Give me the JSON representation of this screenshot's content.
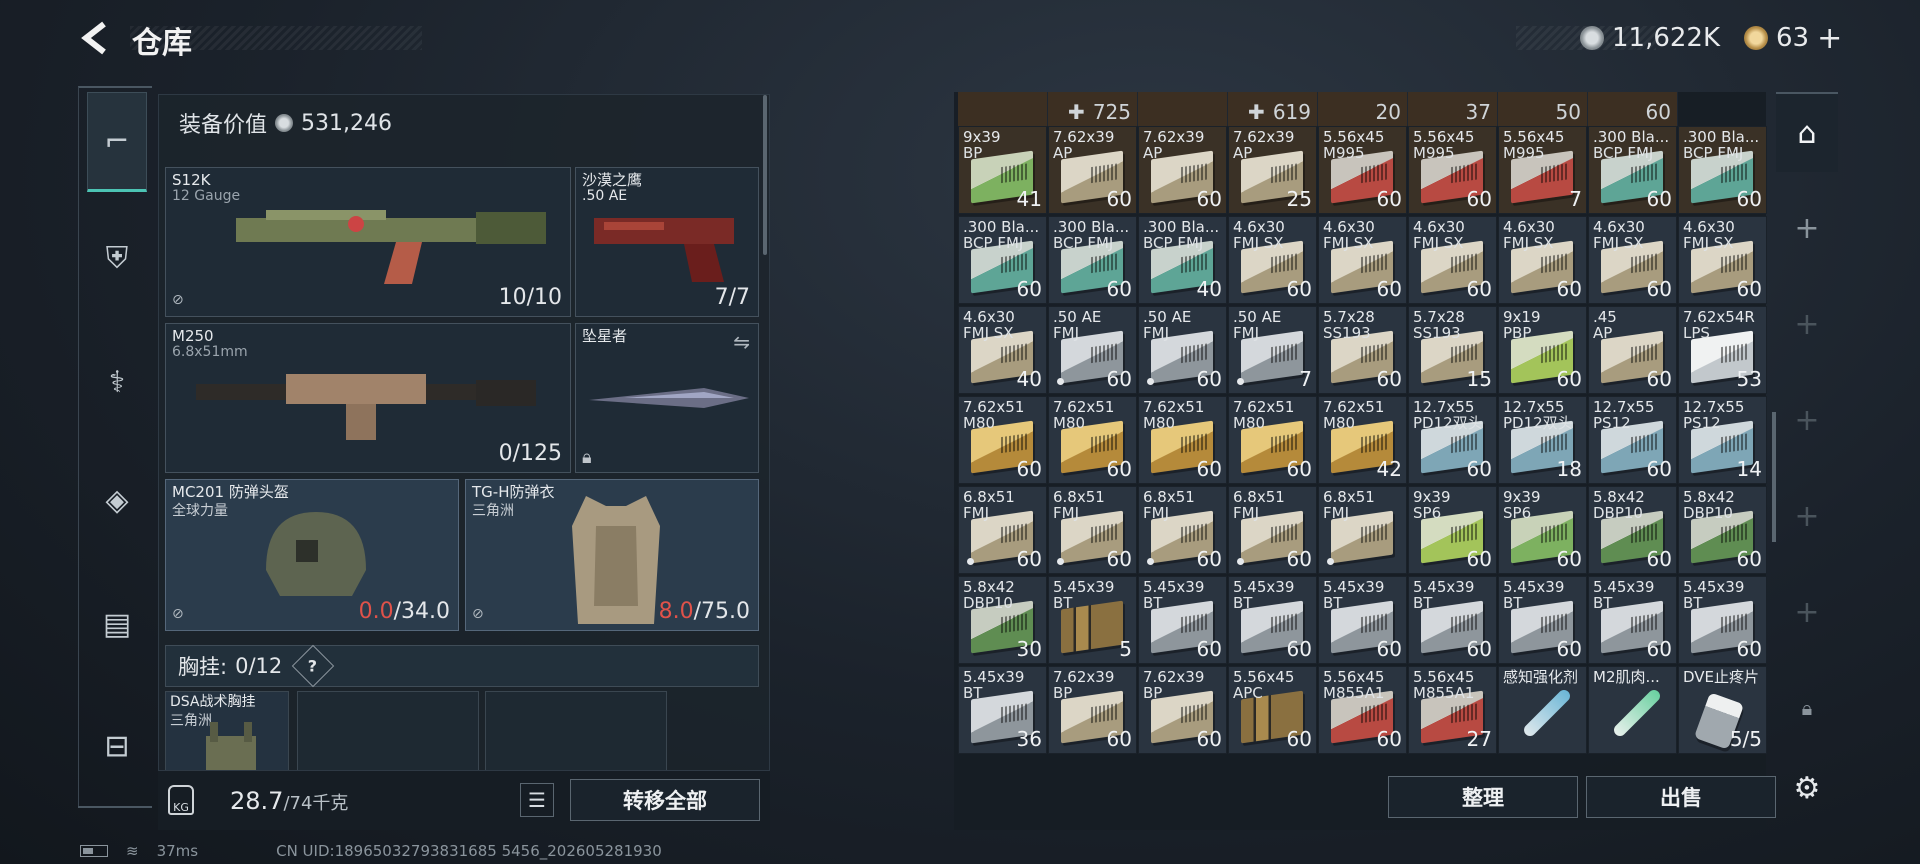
{
  "header": {
    "title": "仓库",
    "currency_silver": "11,622K",
    "currency_gold": "63",
    "plus": "+"
  },
  "equipment": {
    "value_label": "装备价值",
    "value": "531,246",
    "primary": {
      "name": "S12K",
      "ammo": "12 Gauge",
      "count": "10/10"
    },
    "sidearm": {
      "name": "沙漠之鹰",
      "ammo": ".50 AE",
      "count": "7/7"
    },
    "secondary": {
      "name": "M250",
      "ammo": "6.8x51mm",
      "count": "0/125"
    },
    "melee": {
      "name": "坠星者"
    },
    "helmet": {
      "name": "MC201 防弹头盔",
      "brand": "全球力量",
      "dur_current": "0.0",
      "dur_max": "/34.0"
    },
    "armor": {
      "name": "TG-H防弹衣",
      "brand": "三角洲",
      "dur_current": "8.0",
      "dur_max": "/75.0"
    },
    "vest": {
      "label": "胸挂:",
      "capacity": "0/12",
      "help": "?",
      "item_name": "DSA战术胸挂",
      "item_brand": "三角洲"
    },
    "weight": "28.7",
    "weight_max": "/74千克",
    "transfer_all": "转移全部"
  },
  "inventory": {
    "top_row": [
      {
        "prefix": "",
        "q": ""
      },
      {
        "prefix": "✚",
        "q": "725"
      },
      {
        "prefix": "",
        "q": ""
      },
      {
        "prefix": "✚",
        "q": "619"
      },
      {
        "prefix": "",
        "q": "20"
      },
      {
        "prefix": "",
        "q": "37"
      },
      {
        "prefix": "",
        "q": "50"
      },
      {
        "prefix": "",
        "q": "60"
      }
    ],
    "rows": [
      [
        {
          "l1": "9x39",
          "l2": "BP",
          "q": "41",
          "c": "green",
          "w": 1
        },
        {
          "l1": "7.62x39",
          "l2": "AP",
          "q": "60",
          "c": "beige",
          "w": 1
        },
        {
          "l1": "7.62x39",
          "l2": "AP",
          "q": "60",
          "c": "beige",
          "w": 1
        },
        {
          "l1": "7.62x39",
          "l2": "AP",
          "q": "25",
          "c": "beige",
          "w": 1
        },
        {
          "l1": "5.56x45",
          "l2": "M995",
          "q": "60",
          "c": "red",
          "w": 1
        },
        {
          "l1": "5.56x45",
          "l2": "M995",
          "q": "60",
          "c": "red",
          "w": 1
        },
        {
          "l1": "5.56x45",
          "l2": "M995",
          "q": "7",
          "c": "red",
          "w": 1
        },
        {
          "l1": ".300 Bla...",
          "l2": "BCP FMJ",
          "q": "60",
          "c": "teal",
          "w": 0
        },
        {
          "l1": ".300 Bla...",
          "l2": "BCP FMJ",
          "q": "60",
          "c": "teal",
          "w": 0
        }
      ],
      [
        {
          "l1": ".300 Bla...",
          "l2": "BCP FMJ",
          "q": "60",
          "c": "teal"
        },
        {
          "l1": ".300 Bla...",
          "l2": "BCP FMJ",
          "q": "60",
          "c": "teal"
        },
        {
          "l1": ".300 Bla...",
          "l2": "BCP FMJ",
          "q": "40",
          "c": "teal"
        },
        {
          "l1": "4.6x30",
          "l2": "FMJ SX",
          "q": "60",
          "c": "beige"
        },
        {
          "l1": "4.6x30",
          "l2": "FMJ SX",
          "q": "60",
          "c": "beige"
        },
        {
          "l1": "4.6x30",
          "l2": "FMJ SX",
          "q": "60",
          "c": "beige"
        },
        {
          "l1": "4.6x30",
          "l2": "FMJ SX",
          "q": "60",
          "c": "beige"
        },
        {
          "l1": "4.6x30",
          "l2": "FMJ SX",
          "q": "60",
          "c": "beige"
        },
        {
          "l1": "4.6x30",
          "l2": "FMJ SX",
          "q": "60",
          "c": "beige"
        }
      ],
      [
        {
          "l1": "4.6x30",
          "l2": "FMJ SX",
          "q": "40",
          "c": "beige"
        },
        {
          "l1": ".50 AE",
          "l2": "FMJ",
          "q": "60",
          "c": "grey",
          "d": 1
        },
        {
          "l1": ".50 AE",
          "l2": "FMJ",
          "q": "60",
          "c": "grey",
          "d": 1
        },
        {
          "l1": ".50 AE",
          "l2": "FMJ",
          "q": "7",
          "c": "grey",
          "d": 1
        },
        {
          "l1": "5.7x28",
          "l2": "SS193",
          "q": "60",
          "c": "beige"
        },
        {
          "l1": "5.7x28",
          "l2": "SS193",
          "q": "15",
          "c": "beige"
        },
        {
          "l1": "9x19",
          "l2": "PBP",
          "q": "60",
          "c": "lime"
        },
        {
          "l1": ".45",
          "l2": "AP",
          "q": "60",
          "c": "beige"
        },
        {
          "l1": "7.62x54R",
          "l2": "LPS",
          "q": "53",
          "c": "white"
        }
      ],
      [
        {
          "l1": "7.62x51",
          "l2": "M80",
          "q": "60",
          "c": "gold"
        },
        {
          "l1": "7.62x51",
          "l2": "M80",
          "q": "60",
          "c": "gold"
        },
        {
          "l1": "7.62x51",
          "l2": "M80",
          "q": "60",
          "c": "gold"
        },
        {
          "l1": "7.62x51",
          "l2": "M80",
          "q": "60",
          "c": "gold"
        },
        {
          "l1": "7.62x51",
          "l2": "M80",
          "q": "42",
          "c": "gold"
        },
        {
          "l1": "12.7x55",
          "l2": "PD12双头",
          "q": "60",
          "c": "blue"
        },
        {
          "l1": "12.7x55",
          "l2": "PD12双头",
          "q": "18",
          "c": "blue"
        },
        {
          "l1": "12.7x55",
          "l2": "PS12",
          "q": "60",
          "c": "blue"
        },
        {
          "l1": "12.7x55",
          "l2": "PS12",
          "q": "14",
          "c": "blue"
        }
      ],
      [
        {
          "l1": "6.8x51",
          "l2": "FMJ",
          "q": "60",
          "c": "beige",
          "d": 1
        },
        {
          "l1": "6.8x51",
          "l2": "FMJ",
          "q": "60",
          "c": "beige",
          "d": 1
        },
        {
          "l1": "6.8x51",
          "l2": "FMJ",
          "q": "60",
          "c": "beige",
          "d": 1
        },
        {
          "l1": "6.8x51",
          "l2": "FMJ",
          "q": "60",
          "c": "beige",
          "d": 1
        },
        {
          "l1": "6.8x51",
          "l2": "FMJ",
          "q": "",
          "c": "beige",
          "d": 1
        },
        {
          "l1": "9x39",
          "l2": "SP6",
          "q": "60",
          "c": "lime"
        },
        {
          "l1": "9x39",
          "l2": "SP6",
          "q": "60",
          "c": "green"
        },
        {
          "l1": "5.8x42",
          "l2": "DBP10",
          "q": "60",
          "c": "dgreen"
        },
        {
          "l1": "5.8x42",
          "l2": "DBP10",
          "q": "60",
          "c": "dgreen"
        }
      ],
      [
        {
          "l1": "5.8x42",
          "l2": "DBP10",
          "q": "30",
          "c": "dgreen"
        },
        {
          "l1": "5.45x39",
          "l2": "BT",
          "q": "5",
          "c": "rounds"
        },
        {
          "l1": "5.45x39",
          "l2": "BT",
          "q": "60",
          "c": "grey"
        },
        {
          "l1": "5.45x39",
          "l2": "BT",
          "q": "60",
          "c": "grey"
        },
        {
          "l1": "5.45x39",
          "l2": "BT",
          "q": "60",
          "c": "grey"
        },
        {
          "l1": "5.45x39",
          "l2": "BT",
          "q": "60",
          "c": "grey"
        },
        {
          "l1": "5.45x39",
          "l2": "BT",
          "q": "60",
          "c": "grey"
        },
        {
          "l1": "5.45x39",
          "l2": "BT",
          "q": "60",
          "c": "grey"
        },
        {
          "l1": "5.45x39",
          "l2": "BT",
          "q": "60",
          "c": "grey"
        }
      ],
      [
        {
          "l1": "5.45x39",
          "l2": "BT",
          "q": "36",
          "c": "grey"
        },
        {
          "l1": "7.62x39",
          "l2": "BP",
          "q": "60",
          "c": "beige"
        },
        {
          "l1": "7.62x39",
          "l2": "BP",
          "q": "60",
          "c": "beige"
        },
        {
          "l1": "5.56x45",
          "l2": "APC",
          "q": "60",
          "c": "rounds"
        },
        {
          "l1": "5.56x45",
          "l2": "M855A1",
          "q": "60",
          "c": "red"
        },
        {
          "l1": "5.56x45",
          "l2": "M855A1",
          "q": "27",
          "c": "red"
        },
        {
          "l1": "感知强化剂",
          "l2": "",
          "q": "",
          "c": "syringe"
        },
        {
          "l1": "M2肌肉...",
          "l2": "",
          "q": "",
          "c": "syringe g"
        },
        {
          "l1": "DVE止疼片",
          "l2": "",
          "q": "5/5",
          "c": "pill"
        }
      ]
    ],
    "sort_label": "整理",
    "sell_label": "出售"
  },
  "status": {
    "ping": "37ms",
    "uid": "CN UID:18965032793831685 5456_202605281930"
  },
  "colors": {
    "accent": "#4cc4b4",
    "durability_red": "#e0524a"
  }
}
